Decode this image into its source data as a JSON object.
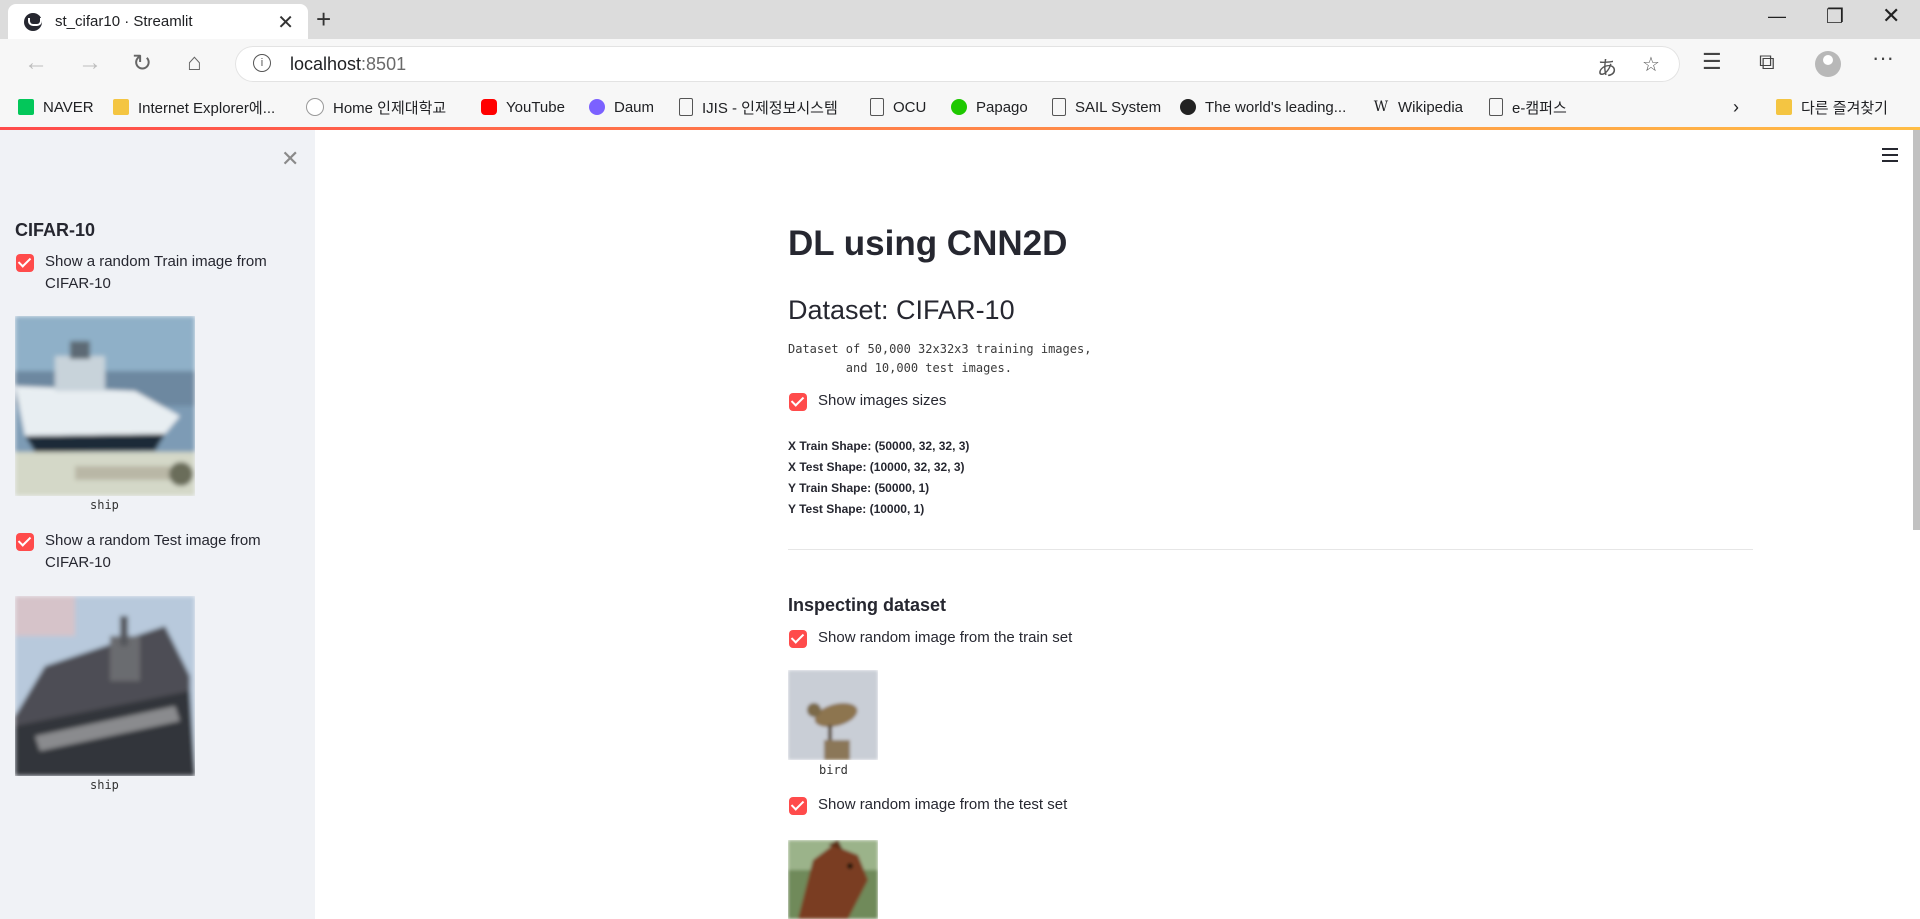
{
  "browser": {
    "tab_title": "st_cifar10 · Streamlit",
    "url_host": "localhost",
    "url_port": ":8501",
    "bookmarks": [
      {
        "label": "NAVER",
        "icon": "naver-icon",
        "color": "#03c75a"
      },
      {
        "label": "Internet Explorer에...",
        "icon": "folder-icon",
        "color": "#f4c542"
      },
      {
        "label": "Home  인제대학교",
        "icon": "globe-icon",
        "color": "#9e9e9e"
      },
      {
        "label": "YouTube",
        "icon": "youtube-icon",
        "color": "#ff0000"
      },
      {
        "label": "Daum",
        "icon": "daum-icon",
        "color": "#7b61ff"
      },
      {
        "label": "IJIS - 인제정보시스템",
        "icon": "page-icon",
        "color": "#ffffff"
      },
      {
        "label": "OCU",
        "icon": "page-icon",
        "color": "#ffffff"
      },
      {
        "label": "Papago",
        "icon": "papago-icon",
        "color": "#1ec800"
      },
      {
        "label": "SAIL System",
        "icon": "page-icon",
        "color": "#ffffff"
      },
      {
        "label": "The world's leading...",
        "icon": "github-icon",
        "color": "#222222"
      },
      {
        "label": "Wikipedia",
        "icon": "wikipedia-icon",
        "color": "#ffffff"
      },
      {
        "label": "e-캠퍼스",
        "icon": "page-icon",
        "color": "#ffffff"
      }
    ],
    "other_bookmarks": "다른 즐겨찾기"
  },
  "sidebar": {
    "title": "CIFAR-10",
    "train_checkbox": "Show a random Train image from CIFAR-10",
    "train_caption": "ship",
    "test_checkbox": "Show a random Test image from CIFAR-10",
    "test_caption": "ship"
  },
  "main": {
    "title": "DL using CNN2D",
    "dataset_header": "Dataset: CIFAR-10",
    "dataset_desc_line1": "Dataset of 50,000 32x32x3 training images,",
    "dataset_desc_line2": "        and 10,000 test images.",
    "show_sizes_label": "Show images sizes",
    "x_train_shape": "X Train Shape: (50000, 32, 32, 3)",
    "x_test_shape": "X Test Shape: (10000, 32, 32, 3)",
    "y_train_shape": "Y Train Shape: (50000, 1)",
    "y_test_shape": "Y Test Shape: (10000, 1)",
    "inspect_header": "Inspecting dataset",
    "train_set_label": "Show random image from the train set",
    "train_set_caption": "bird",
    "test_set_label": "Show random image from the test set"
  },
  "colors": {
    "accent": "#ff4b4b",
    "sidebar_bg": "#f0f2f6",
    "text": "#262730"
  }
}
